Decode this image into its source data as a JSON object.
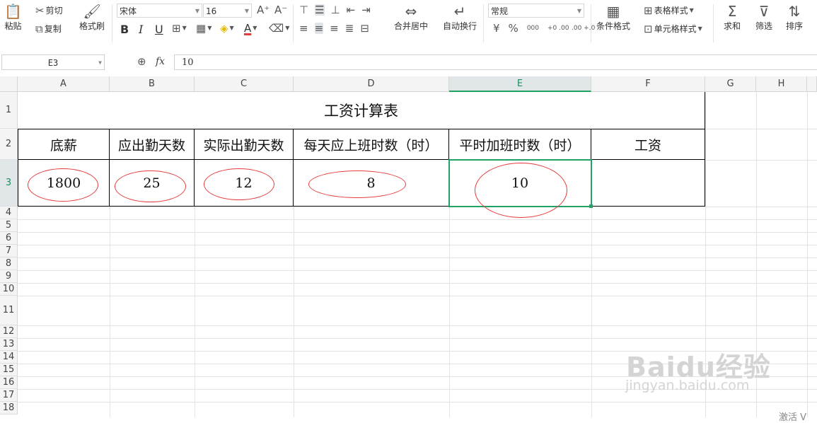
{
  "ribbon": {
    "paste": "粘贴",
    "cut": "剪切",
    "copy": "复制",
    "format_painter": "格式刷",
    "font_name": "宋体",
    "font_size": "16",
    "bold": "B",
    "italic": "I",
    "underline": "U",
    "font_color_glyph": "A",
    "merge_center": "合并居中",
    "wrap_text": "自动换行",
    "number_format": "常规",
    "currency": "¥",
    "percent": "%",
    "thousands": "000",
    "inc_decimal": "+0 .00",
    "dec_decimal": ".00 +.0",
    "conditional_format": "条件格式",
    "table_style": "表格样式",
    "cell_style": "单元格样式",
    "sum": "求和",
    "filter": "筛选",
    "sort": "排序"
  },
  "formula_bar": {
    "name_box": "E3",
    "fx": "fx",
    "content": "10"
  },
  "columns": [
    "A",
    "B",
    "C",
    "D",
    "E",
    "F",
    "G",
    "H"
  ],
  "rows": [
    "1",
    "2",
    "3",
    "4",
    "5",
    "6",
    "7",
    "8",
    "9",
    "10",
    "11",
    "12",
    "13",
    "14",
    "15",
    "16",
    "17",
    "18"
  ],
  "sheet": {
    "title": "工资计算表",
    "headers": [
      "底薪",
      "应出勤天数",
      "实际出勤天数",
      "每天应上班时数（时）",
      "平时加班时数（时）",
      "工资"
    ],
    "values": [
      "1800",
      "25",
      "12",
      "8",
      "10",
      ""
    ]
  },
  "watermark": {
    "brand": "Baidu经验",
    "url": "jingyan.baidu.com",
    "corner_text": "激活 V"
  },
  "colors": {
    "accent_green": "#21a366",
    "annotation_red": "#e53b3b"
  }
}
